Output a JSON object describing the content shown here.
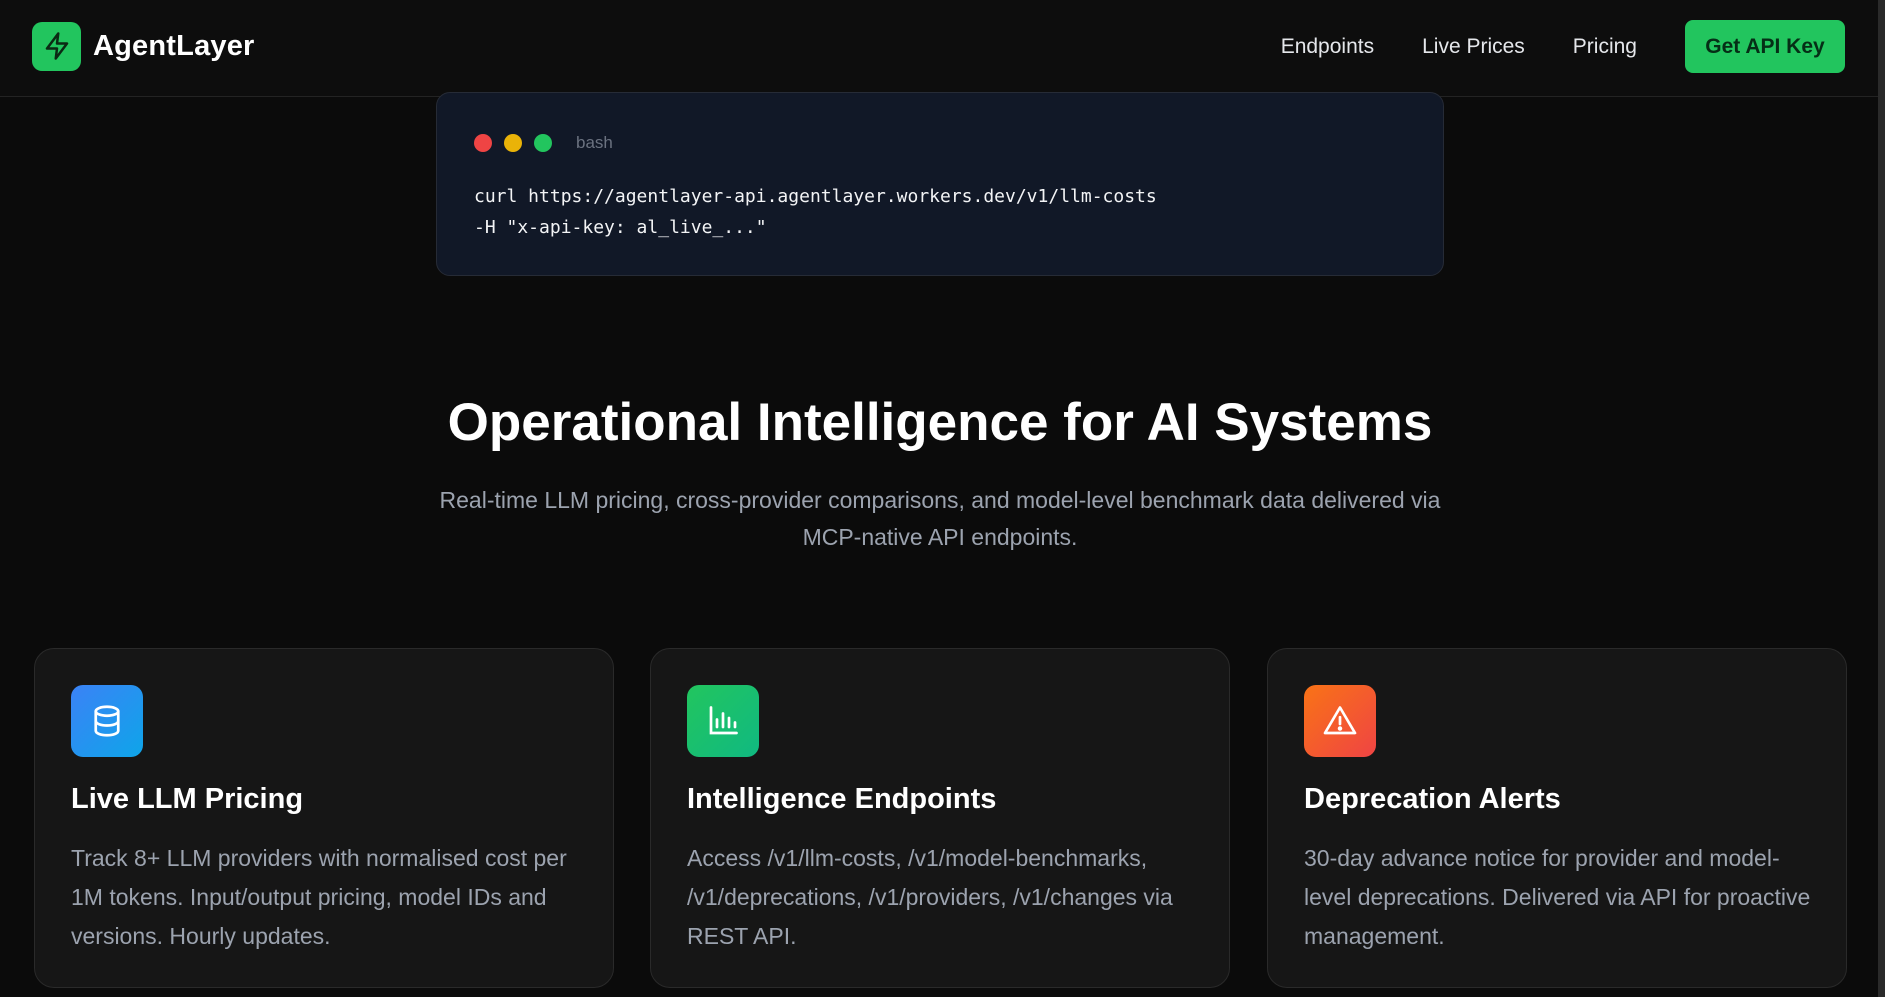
{
  "brand": {
    "name": "AgentLayer",
    "logo_icon": "lightning-bolt-icon",
    "accent": "#22c55e"
  },
  "nav": {
    "links": [
      "Endpoints",
      "Live Prices",
      "Pricing"
    ],
    "cta": "Get API Key"
  },
  "terminal": {
    "lang": "bash",
    "lines": [
      "curl https://agentlayer-api.agentlayer.workers.dev/v1/llm-costs",
      "-H \"x-api-key: al_live_...\""
    ]
  },
  "hero": {
    "title": "Operational Intelligence for AI Systems",
    "subtitle": "Real-time LLM pricing, cross-provider comparisons, and model-level benchmark data delivered via MCP-native API endpoints."
  },
  "features": [
    {
      "icon": "database-icon",
      "title": "Live LLM Pricing",
      "desc": "Track 8+ LLM providers with normalised cost per 1M tokens. Input/output pricing, model IDs and versions. Hourly updates."
    },
    {
      "icon": "bar-chart-icon",
      "title": "Intelligence Endpoints",
      "desc": "Access /v1/llm-costs, /v1/model-benchmarks, /v1/deprecations, /v1/providers, /v1/changes via REST API."
    },
    {
      "icon": "warning-triangle-icon",
      "title": "Deprecation Alerts",
      "desc": "30-day advance notice for provider and model-level deprecations. Delivered via API for proactive management."
    }
  ]
}
